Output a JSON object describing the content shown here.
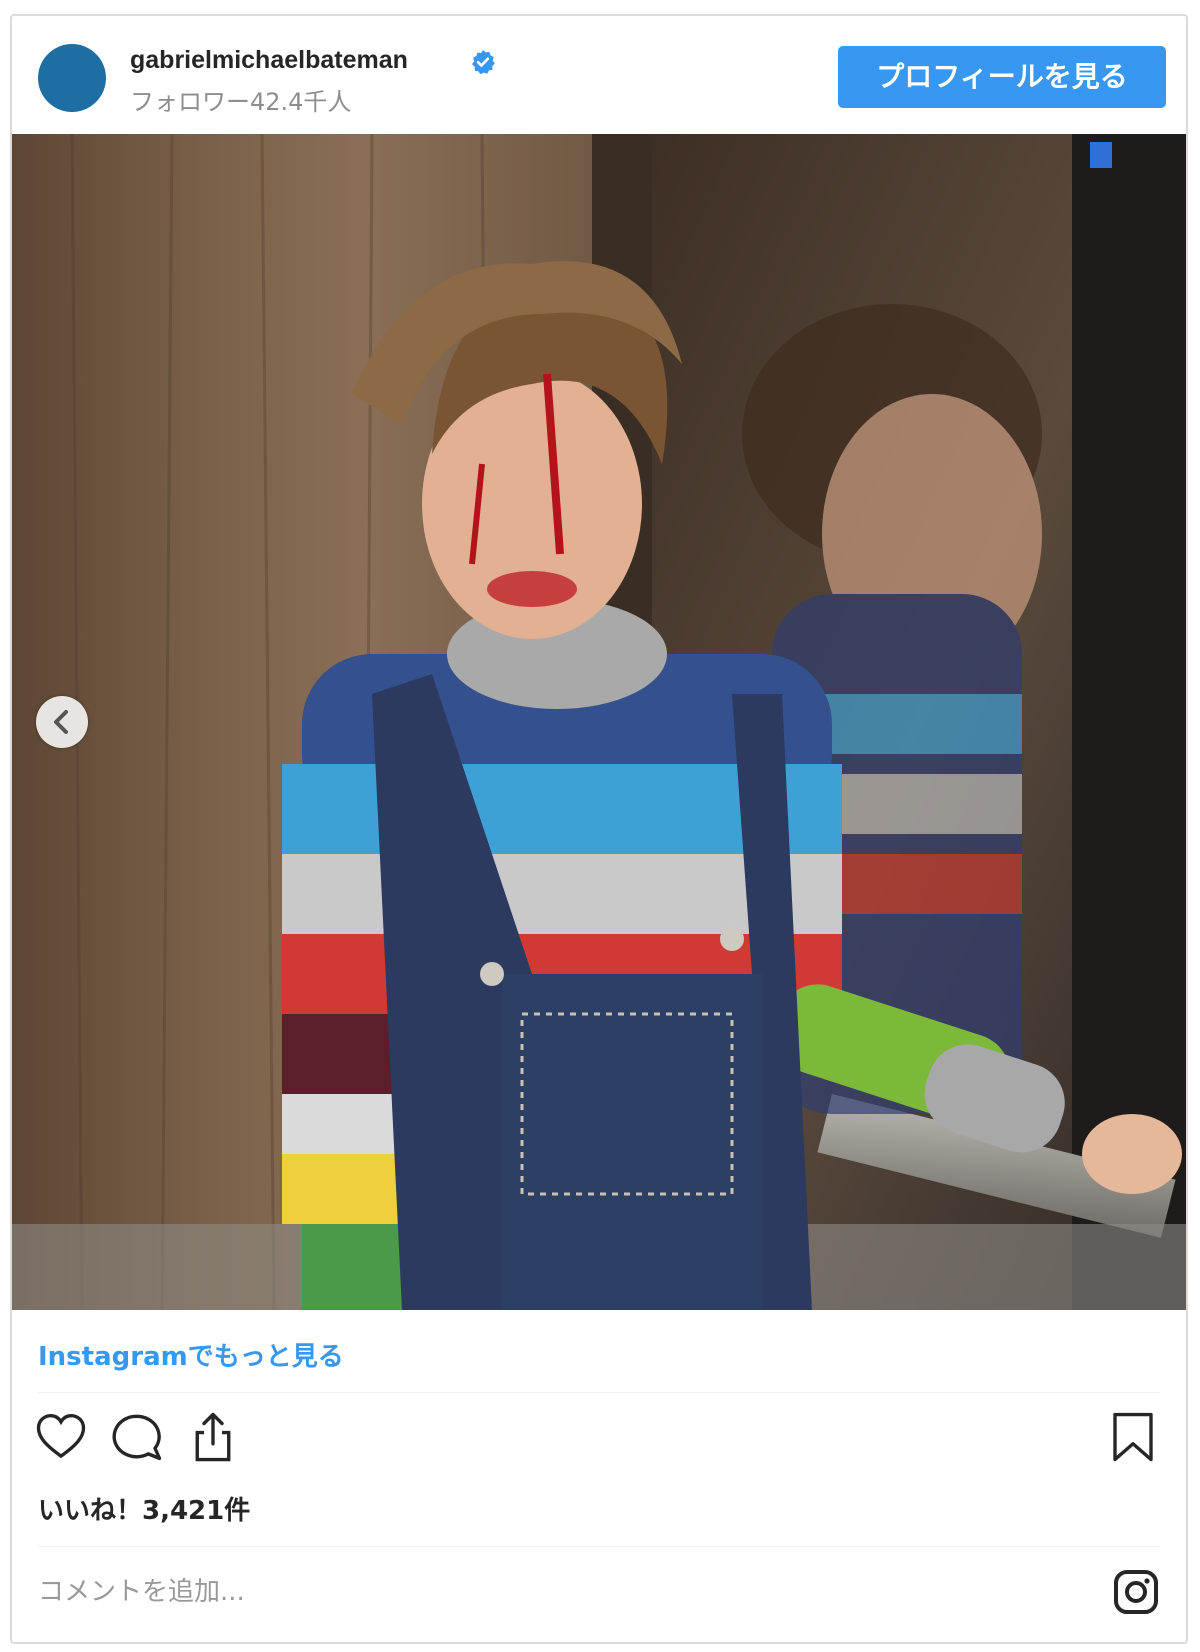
{
  "header": {
    "username": "gabrielmichaelbateman",
    "followers": "フォロワー42.4千人",
    "profile_button": "プロフィールを見る",
    "avatar_color": "#1e6ea4",
    "verified_icon": "verified-badge-icon"
  },
  "photo": {
    "description": "photo",
    "prev_icon": "chevron-left-icon"
  },
  "more_link": "Instagramでもっと見る",
  "actions": {
    "like_icon": "heart-icon",
    "comment_icon": "comment-icon",
    "share_icon": "share-icon",
    "save_icon": "bookmark-icon"
  },
  "likes": "いいね！3,421件",
  "comment": {
    "placeholder": "コメントを追加..."
  },
  "colors": {
    "accent": "#3897f0",
    "border": "#dbdbdb",
    "text": "#262626",
    "muted": "#8e8e8e"
  }
}
